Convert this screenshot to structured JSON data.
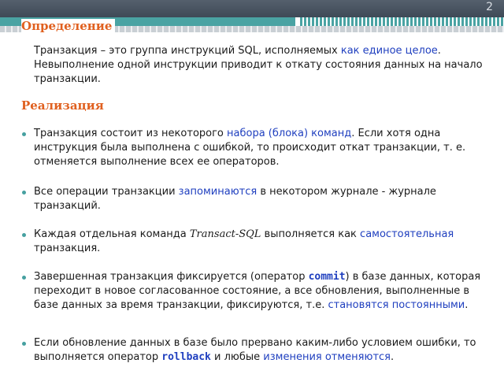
{
  "slide_number": "2",
  "definition": {
    "title": "Определение",
    "pre": "Транзакция – это группа инструкций SQL, исполняемых ",
    "highlight": "как единое целое",
    "post": ". Невыполнение одной инструкции приводит к откату состояния данных на начало транзакции."
  },
  "implementation": {
    "title": "Реализация",
    "bullets": [
      {
        "pre": "Транзакция состоит из некоторого ",
        "highlight": "набора (блока) команд",
        "post": ". Если хотя одна инструкция была выполнена с ошибкой, то происходит откат транзакции, т. е. отменяется выполнение всех ее операторов."
      },
      {
        "pre": "Все операции транзакции ",
        "highlight": "запоминаются",
        "post": " в некотором журнале - журнале транзакций."
      },
      {
        "pre": "Каждая отдельная команда ",
        "italic": "Transact-SQL",
        "mid": " выполняется как ",
        "highlight": "самостоятельная",
        "post": " транзакция."
      },
      {
        "pre": "Завершенная транзакция фиксируется (оператор ",
        "keyword": "commit",
        "mid": ") в базе данных, которая переходит в новое согласованное состояние, а все обновления, выполненные в базе данных за время транзакции, фиксируются, т.е. ",
        "highlight": "становятся постоянными",
        "post": "."
      },
      {
        "pre": "Если обновление данных в базе было прервано каким-либо условием ошибки, то выполняется оператор ",
        "keyword": "rollback",
        "mid": " и любые ",
        "highlight": "изменения отменяются",
        "post": "."
      }
    ]
  },
  "colors": {
    "heading": "#e0601f",
    "highlight": "#1f3fbf",
    "accent_teal": "#4aa3a3",
    "top_bar": "#4a5562"
  }
}
